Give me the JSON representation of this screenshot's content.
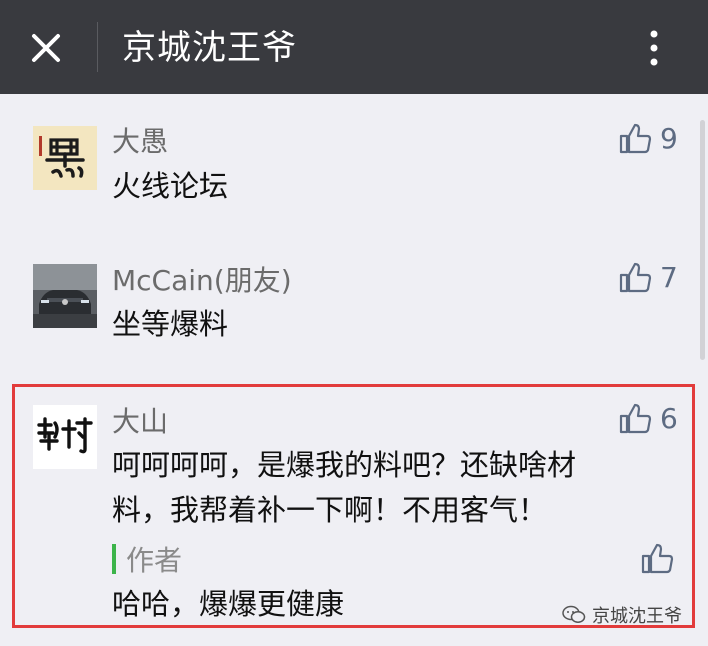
{
  "header": {
    "title": "京城沈王爷",
    "close_icon": "close-icon",
    "more_icon": "more-vertical-icon",
    "background": "#393a3f"
  },
  "comments": [
    {
      "author": "大愚",
      "text_lines": [
        "火线论坛"
      ],
      "likes": "9",
      "avatar": "calligraphy-avatar"
    },
    {
      "author": "McCain(朋友)",
      "text_lines": [
        "坐等爆料"
      ],
      "likes": "7",
      "avatar": "car-avatar"
    },
    {
      "author": "大山",
      "text_lines": [
        "呵呵呵呵，是爆我的料吧？还缺啥材",
        "料，我帮着补一下啊！不用客气！"
      ],
      "likes": "6",
      "avatar": "calligraphy-avatar",
      "reply": {
        "label": "作者",
        "text": "哈哈，爆爆更健康"
      }
    }
  ],
  "watermark": {
    "text": "京城沈王爷",
    "icon": "wechat-icon"
  },
  "colors": {
    "highlight": "#e23b3b",
    "author_bar": "#3cb44a",
    "like": "#5d6b82"
  }
}
